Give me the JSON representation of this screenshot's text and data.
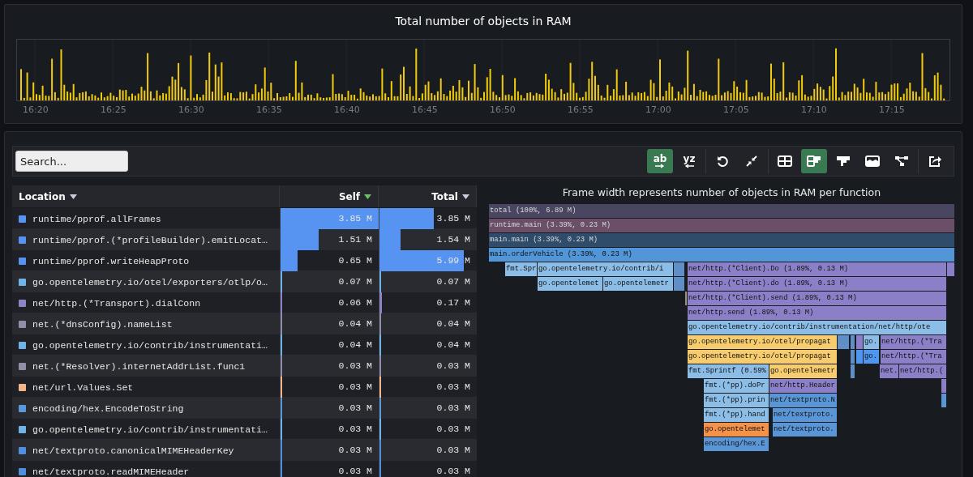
{
  "chart_panel": {
    "title": "Total number of objects in RAM",
    "time_labels": [
      "16:20",
      "16:25",
      "16:30",
      "16:35",
      "16:40",
      "16:45",
      "16:50",
      "16:55",
      "17:00",
      "17:05",
      "17:10",
      "17:15"
    ]
  },
  "toolbar": {
    "search": {
      "placeholder": "Search..."
    },
    "button_groups": [
      [
        {
          "kind": "text-left",
          "label": "ab",
          "selected": true
        },
        {
          "kind": "text-right",
          "label": "yz",
          "selected": false
        }
      ],
      [
        {
          "kind": "reset",
          "selected": false
        },
        {
          "kind": "collapse",
          "selected": false
        }
      ],
      [
        {
          "kind": "table",
          "selected": false
        },
        {
          "kind": "split",
          "selected": true
        },
        {
          "kind": "flame",
          "selected": false
        },
        {
          "kind": "sandwich",
          "selected": false
        },
        {
          "kind": "graph",
          "selected": false
        }
      ],
      [
        {
          "kind": "export",
          "selected": false
        }
      ]
    ]
  },
  "table": {
    "columns": [
      {
        "label": "Location",
        "sorted": false
      },
      {
        "label": "Self",
        "sorted": true
      },
      {
        "label": "Total",
        "sorted": false
      }
    ],
    "rows": [
      {
        "location": "runtime/pprof.allFrames",
        "color": "#5794f2",
        "self": {
          "value": "3.85 M",
          "level": 1
        },
        "total": {
          "value": "3.85 M",
          "level": 0.56
        }
      },
      {
        "location": "runtime/pprof.(*profileBuilder).emitLocat…",
        "color": "#5794f2",
        "self": {
          "value": "1.51 M",
          "level": 0.39
        },
        "total": {
          "value": "1.54 M",
          "level": 0.22
        }
      },
      {
        "location": "runtime/pprof.writeHeapProto",
        "color": "#5794f2",
        "self": {
          "value": "0.65 M",
          "level": 0.17
        },
        "total": {
          "value": "5.99 M",
          "level": 0.87
        }
      },
      {
        "location": "go.opentelemetry.io/otel/exporters/otlp/o…",
        "color": "#6fb4e6",
        "self": {
          "value": "0.07 M",
          "level": 0.018
        },
        "total": {
          "value": "0.07 M",
          "level": 0.01
        }
      },
      {
        "location": "net/http.(*Transport).dialConn",
        "color": "#8a86c4",
        "self": {
          "value": "0.06 M",
          "level": 0.016
        },
        "total": {
          "value": "0.17 M",
          "level": 0.025
        }
      },
      {
        "location": "net.(*dnsConfig).nameList",
        "color": "#928ea8",
        "self": {
          "value": "0.04 M",
          "level": 0.01
        },
        "total": {
          "value": "0.04 M",
          "level": 0.006
        }
      },
      {
        "location": "go.opentelemetry.io/contrib/instrumentati…",
        "color": "#6fb4e6",
        "self": {
          "value": "0.04 M",
          "level": 0.01
        },
        "total": {
          "value": "0.04 M",
          "level": 0.006
        }
      },
      {
        "location": "net.(*Resolver).internetAddrList.func1",
        "color": "#928ea8",
        "self": {
          "value": "0.03 M",
          "level": 0.008
        },
        "total": {
          "value": "0.03 M",
          "level": 0.005
        }
      },
      {
        "location": "net/url.Values.Set",
        "color": "#f2b68a",
        "self": {
          "value": "0.03 M",
          "level": 0.008
        },
        "total": {
          "value": "0.03 M",
          "level": 0.005
        }
      },
      {
        "location": "encoding/hex.EncodeToString",
        "color": "#5a97dd",
        "self": {
          "value": "0.03 M",
          "level": 0.008
        },
        "total": {
          "value": "0.03 M",
          "level": 0.005
        }
      },
      {
        "location": "go.opentelemetry.io/contrib/instrumentati…",
        "color": "#6fb4e6",
        "self": {
          "value": "0.03 M",
          "level": 0.008
        },
        "total": {
          "value": "0.03 M",
          "level": 0.005
        }
      },
      {
        "location": "net/textproto.canonicalMIMEHeaderKey",
        "color": "#4f8fe0",
        "self": {
          "value": "0.03 M",
          "level": 0.008
        },
        "total": {
          "value": "0.03 M",
          "level": 0.005
        }
      },
      {
        "location": "net/textproto.readMIMEHeader",
        "color": "#4f8fe0",
        "self": {
          "value": "0.03 M",
          "level": 0.008
        },
        "total": {
          "value": "0.03 M",
          "level": 0.005
        }
      }
    ]
  },
  "flame_graph": {
    "title": "Frame width represents number of objects in RAM per function",
    "rows": [
      {
        "frames": [
          {
            "label": "total (100%, 6.89 M)",
            "color": "#4a4661"
          }
        ]
      },
      {
        "frames": [
          {
            "label": "runtime.main (3.39%, 0.23 M)",
            "color": "#6b4f68"
          }
        ]
      },
      {
        "frames": [
          {
            "label": "main.main (3.39%, 0.23 M)",
            "color": "#2f4d6b"
          }
        ]
      },
      {
        "frames": [
          {
            "label": "main.orderVehicle (3.39%, 0.23 M)",
            "color": "#5296d8"
          }
        ]
      },
      {
        "frames": [
          {
            "label": "fmt.Spr",
            "color": "#8cbde6"
          },
          {
            "label": "go.opentelemetry.io/contrib/i",
            "color": "#8cbde6"
          },
          {
            "color": "#5f8fc4"
          },
          {
            "label": "net/http.(*Client).Do (1.89%, 0.13 M)",
            "color": "#8b80c8"
          },
          {
            "color": "#8b80c8"
          }
        ]
      },
      {
        "frames": [
          {
            "label": "go.opentelemet",
            "color": "#8cbde6"
          },
          {
            "label": "go.opentelemetr",
            "color": "#8cbde6"
          },
          {
            "color": "#5f8fc4"
          },
          {
            "label": "net/http.(*Client).do (1.89%, 0.13 M)",
            "color": "#8b80c8"
          }
        ]
      },
      {
        "frames": [
          {
            "color": "#9a9080"
          },
          {
            "label": "net/http.(*Client).send (1.89%, 0.13 M)",
            "color": "#8b80c8"
          }
        ]
      },
      {
        "frames": [
          {
            "label": "net/http.send (1.89%, 0.13 M)",
            "color": "#8b80c8"
          }
        ]
      },
      {
        "frames": [
          {
            "label": "go.opentelemetry.io/contrib/instrumentation/net/http/ote",
            "color": "#8cbde6"
          }
        ]
      },
      {
        "frames": [
          {
            "label": "go.opentelemetry.io/otel/propagat",
            "color": "#f6cc6e"
          },
          {
            "color": "#5f8fc4"
          },
          {
            "color": "#5f8fc4"
          },
          {
            "color": "#8b80c8"
          },
          {
            "label": "go.",
            "color": "#8cbde6"
          },
          {
            "label": "net/http.(*Tra",
            "color": "#8b80c8"
          }
        ]
      },
      {
        "frames": [
          {
            "label": "go.opentelemetry.io/otel/propagat",
            "color": "#f6cc6e"
          },
          {
            "color": "#5f8fc4"
          },
          {
            "color": "#4f96f0"
          },
          {
            "label": "go.",
            "color": "#4f96f0"
          },
          {
            "label": "net/http.(*Tra",
            "color": "#8b80c8"
          }
        ]
      },
      {
        "frames": [
          {
            "label": "fmt.Sprintf (0.59%",
            "color": "#8cbde6"
          },
          {
            "label": "go.opentelemetr",
            "color": "#f6cc6e"
          },
          {
            "color": "#5f8fc4"
          },
          {
            "label": "net.",
            "color": "#8b80c8"
          },
          {
            "label": "net/http.(",
            "color": "#8b80c8"
          }
        ]
      },
      {
        "frames": [
          {
            "label": "fmt.(*pp).doPr",
            "color": "#8cbde6"
          },
          {
            "label": "net/http.Header",
            "color": "#8b80c8"
          },
          {
            "color": "#8b80c8"
          }
        ]
      },
      {
        "frames": [
          {
            "label": "fmt.(*pp).prin",
            "color": "#8cbde6"
          },
          {
            "label": "net/textproto.N",
            "color": "#5a95d6"
          },
          {
            "color": "#5a95d6"
          }
        ]
      },
      {
        "frames": [
          {
            "label": "fmt.(*pp).hand",
            "color": "#8cbde6"
          },
          {
            "label": "net/textproto.",
            "color": "#5a95d6"
          }
        ]
      },
      {
        "frames": [
          {
            "label": "go.opentelemet",
            "color": "#f4924a"
          },
          {
            "label": "net/textproto.",
            "color": "#5a95d6"
          }
        ]
      },
      {
        "frames": [
          {
            "label": "encoding/hex.E",
            "color": "#5a95d6"
          }
        ]
      }
    ]
  }
}
